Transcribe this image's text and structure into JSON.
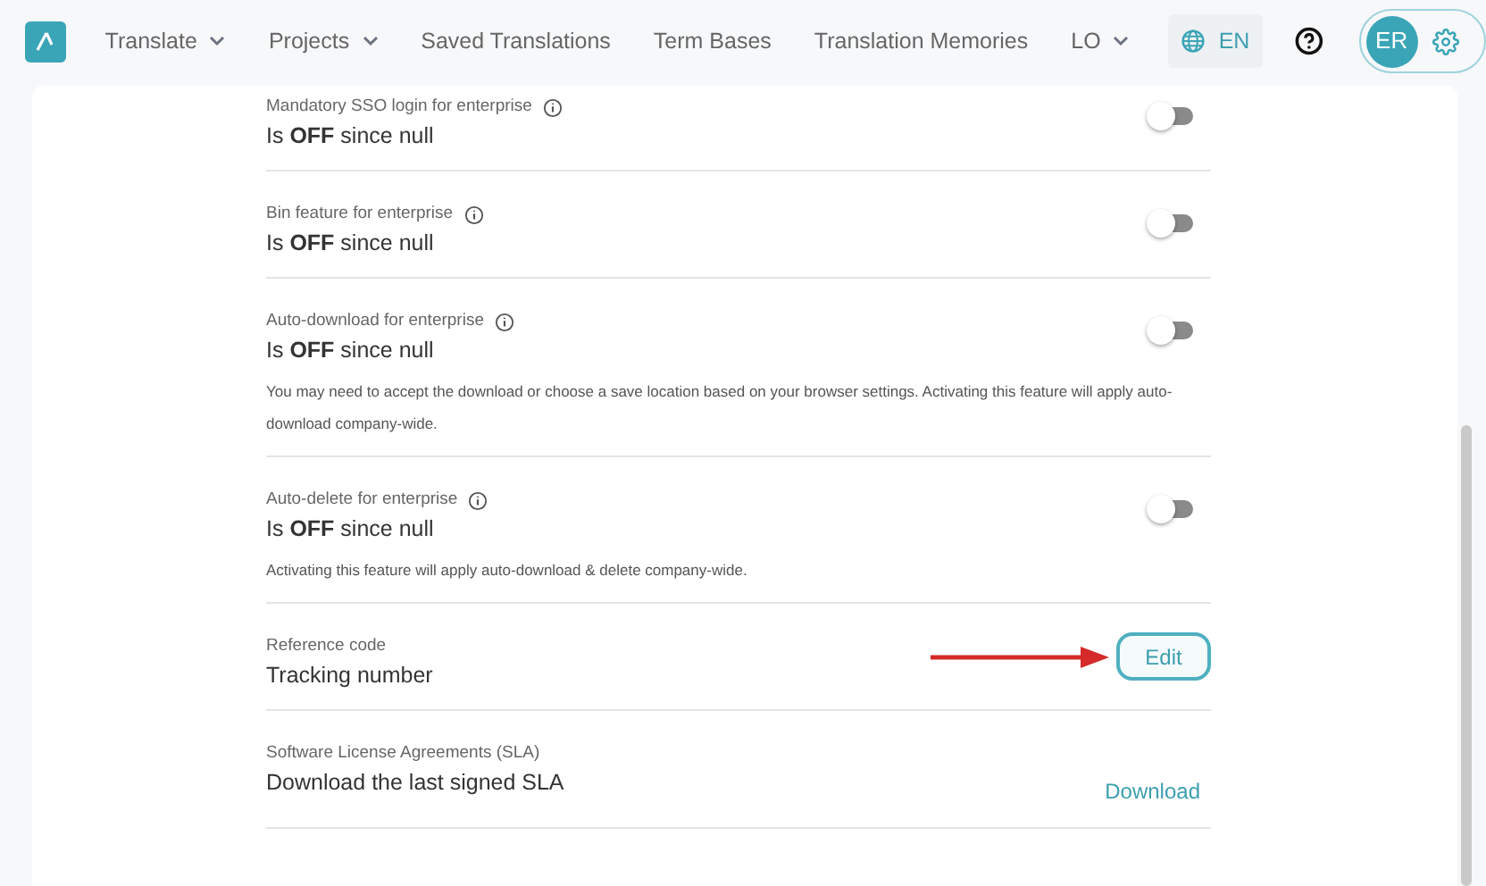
{
  "nav": {
    "items": [
      {
        "label": "Translate",
        "dropdown": true
      },
      {
        "label": "Projects",
        "dropdown": true
      },
      {
        "label": "Saved Translations",
        "dropdown": false
      },
      {
        "label": "Term Bases",
        "dropdown": false
      },
      {
        "label": "Translation Memories",
        "dropdown": false
      },
      {
        "label": "LO",
        "dropdown": true
      }
    ],
    "language": "EN",
    "avatar": "ER"
  },
  "settings": [
    {
      "kind": "toggle",
      "label": "Mandatory SSO login for enterprise",
      "info": true,
      "value": "Is **OFF** since null",
      "on": false
    },
    {
      "kind": "toggle",
      "label": "Bin feature for enterprise",
      "info": true,
      "value": "Is **OFF** since null",
      "on": false
    },
    {
      "kind": "toggle",
      "label": "Auto-download for enterprise",
      "info": true,
      "value": "Is **OFF** since null",
      "on": false,
      "description": "You may need to accept the download or choose a save location based on your browser settings. Activating this feature will apply auto-download company-wide."
    },
    {
      "kind": "toggle",
      "label": "Auto-delete for enterprise",
      "info": true,
      "value": "Is **OFF** since null",
      "on": false,
      "description": "Activating this feature will apply auto-download & delete company-wide."
    },
    {
      "kind": "button",
      "label": "Reference code",
      "info": false,
      "value": "Tracking number",
      "action": "Edit",
      "pointer": true
    },
    {
      "kind": "link",
      "label": "Software License Agreements (SLA)",
      "info": false,
      "value": "Download the last signed SLA",
      "action": "Download"
    }
  ]
}
